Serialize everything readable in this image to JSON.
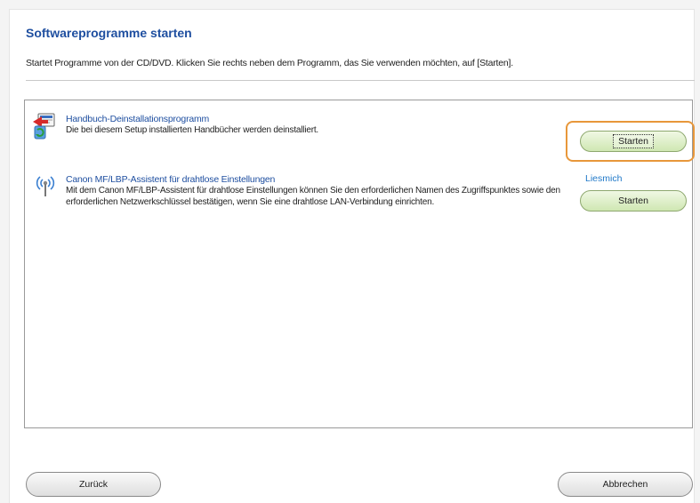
{
  "header": {
    "title": "Softwareprogramme starten",
    "description": "Startet Programme von der CD/DVD. Klicken Sie rechts neben dem Programm, das Sie verwenden möchten, auf [Starten]."
  },
  "programs": [
    {
      "icon": "uninstall-manual-icon",
      "name": "Handbuch-Deinstallationsprogramm",
      "description": "Die bei diesem Setup installierten Handbücher werden deinstalliert.",
      "start_label": "Starten"
    },
    {
      "icon": "wireless-icon",
      "name": "Canon MF/LBP-Assistent für drahtlose Einstellungen",
      "description": "Mit dem Canon MF/LBP-Assistent für drahtlose Einstellungen können Sie den erforderlichen Namen des Zugriffspunktes sowie den erforderlichen Netzwerkschlüssel bestätigen, wenn Sie eine drahtlose LAN-Verbindung einrichten.",
      "readme_label": "Liesmich",
      "start_label": "Starten"
    }
  ],
  "footer": {
    "back_label": "Zurück",
    "cancel_label": "Abbrechen"
  },
  "colors": {
    "title": "#1f4fa0",
    "link": "#1f78c8",
    "highlight": "#e8973a",
    "start_button": "#cfe7b2"
  }
}
